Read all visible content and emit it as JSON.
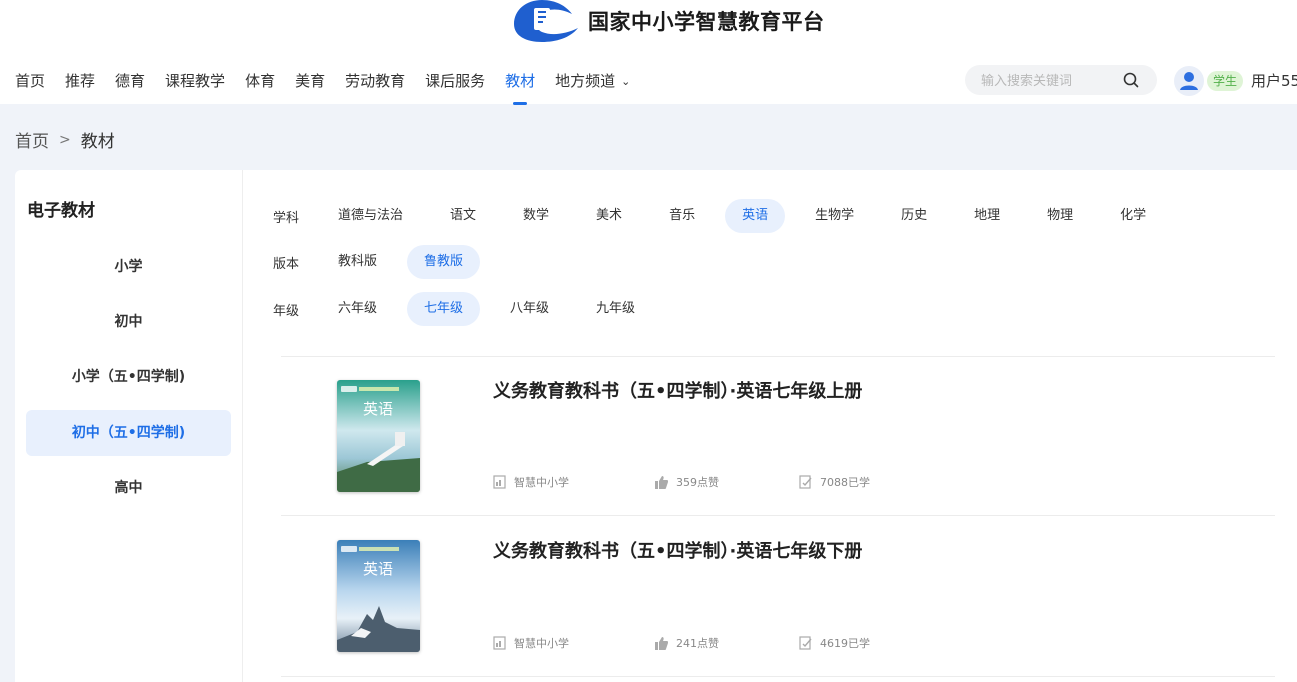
{
  "header": {
    "site_title": "国家中小学智慧教育平台",
    "nav": [
      {
        "label": "首页"
      },
      {
        "label": "推荐"
      },
      {
        "label": "德育"
      },
      {
        "label": "课程教学"
      },
      {
        "label": "体育"
      },
      {
        "label": "美育"
      },
      {
        "label": "劳动教育"
      },
      {
        "label": "课后服务"
      },
      {
        "label": "教材",
        "active": true
      },
      {
        "label": "地方频道"
      }
    ],
    "search_placeholder": "输入搜索关键词",
    "role_badge": "学生",
    "username": "用户55"
  },
  "breadcrumb": {
    "home": "首页",
    "separator": ">",
    "current": "教材"
  },
  "sidebar": {
    "title": "电子教材",
    "items": [
      "小学",
      "初中",
      "小学（五•四学制)",
      "初中（五•四学制)",
      "高中"
    ],
    "active_index": 3
  },
  "filters": {
    "subject": {
      "label": "学科",
      "options": [
        "道德与法治",
        "语文",
        "数学",
        "美术",
        "音乐",
        "英语",
        "生物学",
        "历史",
        "地理",
        "物理",
        "化学"
      ],
      "selected": "英语"
    },
    "edition": {
      "label": "版本",
      "options": [
        "教科版",
        "鲁教版"
      ],
      "selected": "鲁教版"
    },
    "grade": {
      "label": "年级",
      "options": [
        "六年级",
        "七年级",
        "八年级",
        "九年级"
      ],
      "selected": "七年级"
    }
  },
  "books": [
    {
      "title": "义务教育教科书（五•四学制）·英语七年级上册",
      "cover_text": "英语",
      "publisher": "智慧中小学",
      "likes": "359点赞",
      "learners": "7088已学"
    },
    {
      "title": "义务教育教科书（五•四学制）·英语七年级下册",
      "cover_text": "英语",
      "publisher": "智慧中小学",
      "likes": "241点赞",
      "learners": "4619已学"
    }
  ],
  "colors": {
    "accent": "#1e6ee6",
    "accent_bg": "#e8f0fd",
    "page_bg": "#f0f3f9",
    "badge_bg": "#dff4d6",
    "badge_text": "#52b04a"
  }
}
